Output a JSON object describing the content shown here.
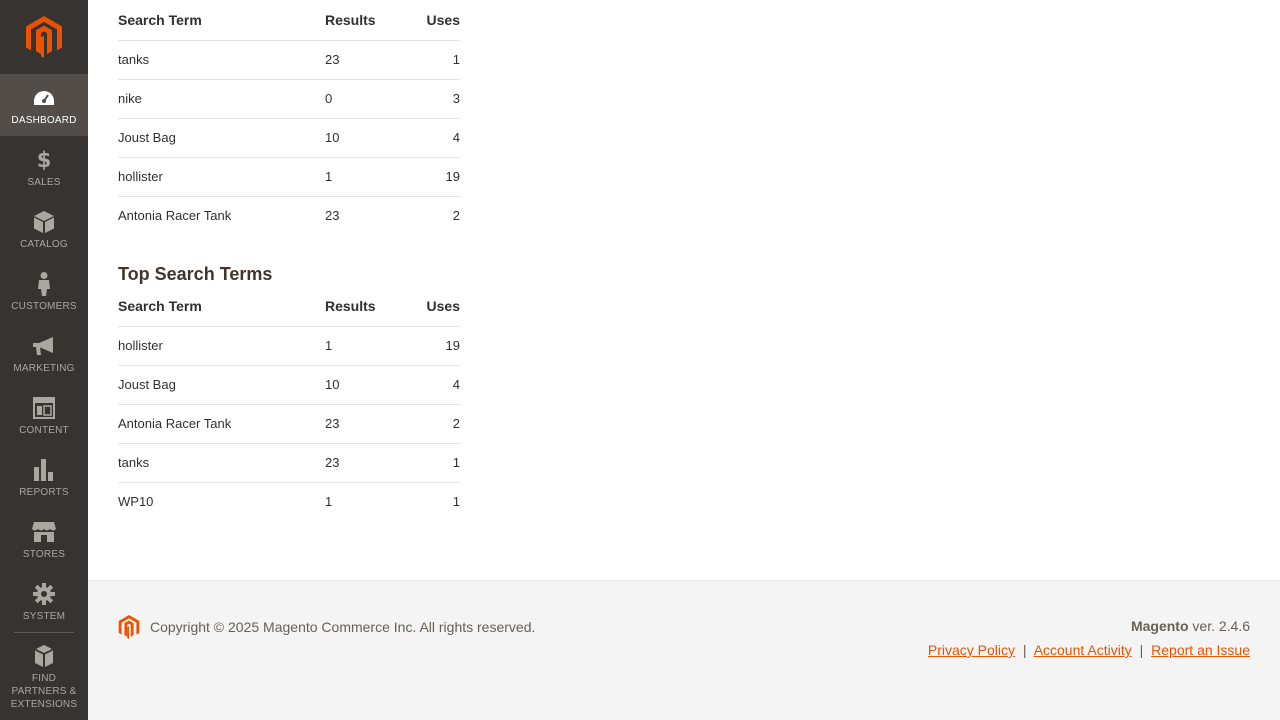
{
  "sidebar": {
    "logo": "magento-logo",
    "items": [
      {
        "label": "Dashboard",
        "icon": "dashboard-icon",
        "active": true
      },
      {
        "label": "Sales",
        "icon": "dollar-icon"
      },
      {
        "label": "Catalog",
        "icon": "box-icon"
      },
      {
        "label": "Customers",
        "icon": "person-icon"
      },
      {
        "label": "Marketing",
        "icon": "megaphone-icon"
      },
      {
        "label": "Content",
        "icon": "layout-icon"
      },
      {
        "label": "Reports",
        "icon": "bar-chart-icon"
      },
      {
        "label": "Stores",
        "icon": "storefront-icon"
      },
      {
        "label": "System",
        "icon": "gear-icon"
      },
      {
        "label": "Find Partners & Extensions",
        "icon": "cubes-icon"
      }
    ]
  },
  "last_search": {
    "headers": {
      "term": "Search Term",
      "results": "Results",
      "uses": "Uses"
    },
    "rows": [
      {
        "term": "tanks",
        "results": "23",
        "uses": "1"
      },
      {
        "term": "nike",
        "results": "0",
        "uses": "3"
      },
      {
        "term": "Joust Bag",
        "results": "10",
        "uses": "4"
      },
      {
        "term": "hollister",
        "results": "1",
        "uses": "19"
      },
      {
        "term": "Antonia Racer Tank",
        "results": "23",
        "uses": "2"
      }
    ]
  },
  "top_search": {
    "title": "Top Search Terms",
    "headers": {
      "term": "Search Term",
      "results": "Results",
      "uses": "Uses"
    },
    "rows": [
      {
        "term": "hollister",
        "results": "1",
        "uses": "19"
      },
      {
        "term": "Joust Bag",
        "results": "10",
        "uses": "4"
      },
      {
        "term": "Antonia Racer Tank",
        "results": "23",
        "uses": "2"
      },
      {
        "term": "tanks",
        "results": "23",
        "uses": "1"
      },
      {
        "term": "WP10",
        "results": "1",
        "uses": "1"
      }
    ]
  },
  "footer": {
    "copyright": "Copyright © 2025 Magento Commerce Inc. All rights reserved.",
    "brand": "Magento",
    "version": " ver. 2.4.6",
    "links": {
      "privacy": "Privacy Policy",
      "activity": " Account Activity",
      "report": "Report an Issue"
    },
    "separator": "|"
  },
  "colors": {
    "accent": "#eb5202",
    "sidebar": "#373330"
  }
}
